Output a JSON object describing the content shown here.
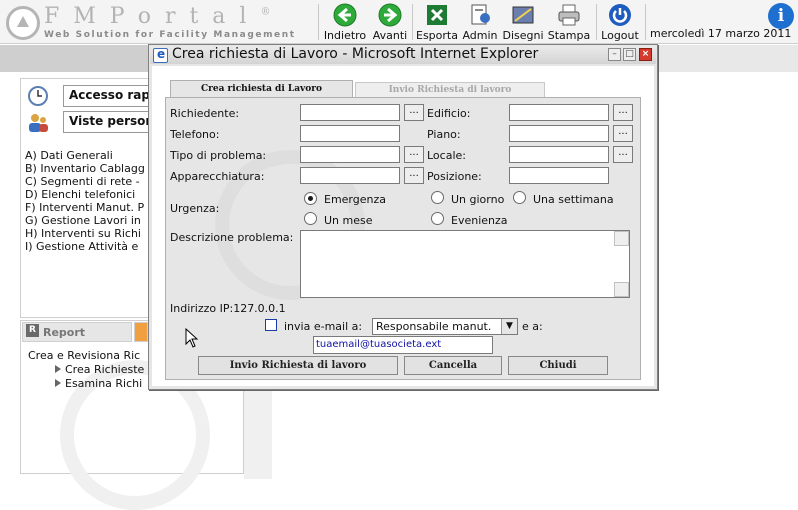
{
  "header": {
    "logo_text": "FMPortal",
    "logo_registered": "®",
    "logo_tagline": "Web Solution for Facility Management",
    "toolbar": [
      {
        "label": "Indietro",
        "icon": "back-arrow-icon"
      },
      {
        "label": "Avanti",
        "icon": "forward-arrow-icon"
      },
      {
        "label": "Esporta",
        "icon": "excel-icon"
      },
      {
        "label": "Admin",
        "icon": "admin-icon"
      },
      {
        "label": "Disegni",
        "icon": "drawings-icon"
      },
      {
        "label": "Stampa",
        "icon": "printer-icon"
      },
      {
        "label": "Logout",
        "icon": "power-icon"
      }
    ],
    "date": "mercoledì 17 marzo 2011",
    "info_glyph": "i"
  },
  "sidebar": {
    "quick_links": [
      {
        "label": "Accesso rapi",
        "icon": "clock-icon"
      },
      {
        "label": "Viste persona",
        "icon": "users-icon"
      }
    ],
    "menu": [
      "A) Dati Generali",
      "B) Inventario Cablagg",
      "C) Segmenti di rete -",
      "D) Elenchi telefonici",
      "F) Interventi Manut. P",
      "G) Gestione Lavori in",
      "H) Interventi su Richi",
      "I) Gestione Attività e"
    ],
    "report_tab": "Report",
    "report_tab_icon": "R",
    "tree": {
      "root": "Crea e Revisiona Ric",
      "children": [
        "Crea Richieste",
        "Esamina Richi"
      ]
    }
  },
  "dialog": {
    "title": "Crea richiesta di Lavoro - Microsoft Internet Explorer",
    "window_buttons": {
      "minimize": "–",
      "maximize": "□",
      "close": "×"
    },
    "tabs": [
      "Crea richiesta di Lavoro",
      "Invio Richiesta di lavoro"
    ],
    "fields": {
      "richiedente": "Richiedente:",
      "telefono": "Telefono:",
      "tipo_problema": "Tipo di problema:",
      "apparecchiatura": "Apparecchiatura:",
      "edificio": "Edificio:",
      "piano": "Piano:",
      "locale": "Locale:",
      "posizione": "Posizione:"
    },
    "lookup_label": "...",
    "urgenza_label": "Urgenza:",
    "urgenza_options": [
      "Emergenza",
      "Un giorno",
      "Una settimana",
      "Un mese",
      "Evenienza"
    ],
    "urgenza_selected": "Emergenza",
    "descrizione_label": "Descrizione problema:",
    "ip_text": "Indirizzo IP:127.0.0.1",
    "email_checkbox_label": "invia e-mail a:",
    "email_select_value": "Responsabile manut.",
    "email_and_label": "e a:",
    "email_value": "tuaemail@tuasocieta.ext",
    "buttons": {
      "submit": "Invio Richiesta di lavoro",
      "cancel": "Cancella",
      "close": "Chiudi"
    }
  },
  "colors": {
    "accent_blue": "#1f6fd0",
    "dialog_bg": "#e6e6e6",
    "close_red": "#d43b2e"
  }
}
